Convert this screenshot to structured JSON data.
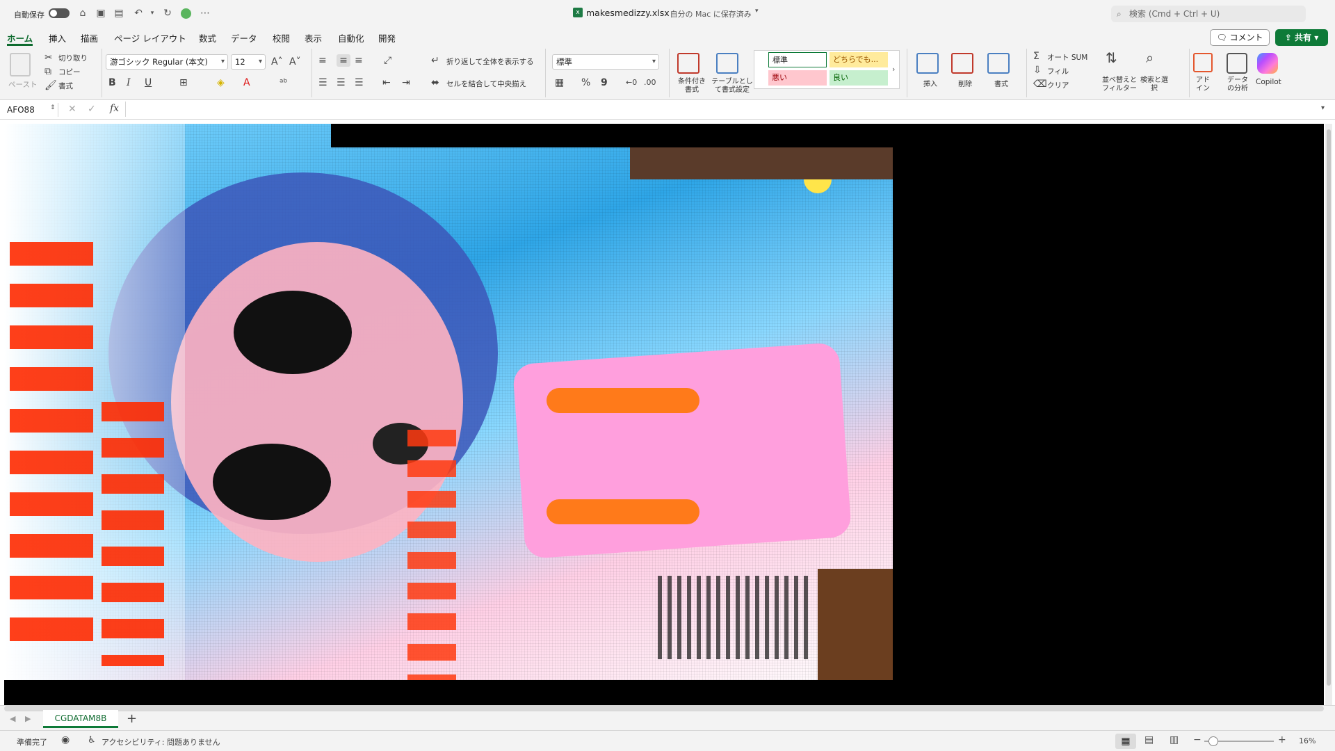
{
  "titlebar": {
    "autosave_label": "自動保存",
    "file_name": "makesmedizzy.xlsx",
    "save_status": "- 自分の Mac に保存済み",
    "search_placeholder": "検索 (Cmd + Ctrl + U)",
    "comment_label": "コメント",
    "share_label": "共有"
  },
  "ribbon_tabs": [
    {
      "label": "ホーム",
      "active": true
    },
    {
      "label": "挿入"
    },
    {
      "label": "描画"
    },
    {
      "label": "ページ レイアウト"
    },
    {
      "label": "数式"
    },
    {
      "label": "データ"
    },
    {
      "label": "校閲"
    },
    {
      "label": "表示"
    },
    {
      "label": "自動化"
    },
    {
      "label": "開発"
    }
  ],
  "clipboard": {
    "paste": "ペースト",
    "cut": "切り取り",
    "copy": "コピー",
    "format_painter": "書式"
  },
  "font": {
    "name": "游ゴシック Regular (本文)",
    "size": "12",
    "bold": "B",
    "italic": "I",
    "underline": "U"
  },
  "alignment": {
    "wrap_text": "折り返して全体を表示する",
    "merge_center": "セルを結合して中央揃え"
  },
  "number": {
    "format": "標準",
    "percent": "%",
    "comma": "9"
  },
  "styles": {
    "conditional": "条件付き書式",
    "as_table": "テーブルとして書式設定",
    "normal": "標準",
    "neutral": "どちらでも...",
    "bad": "悪い",
    "good": "良い"
  },
  "cells": {
    "insert": "挿入",
    "delete": "削除",
    "format": "書式"
  },
  "editing": {
    "autosum": "オート SUM",
    "fill": "フィル",
    "clear": "クリア",
    "sort_filter": "並べ替えとフィルター",
    "find_select": "検索と選択"
  },
  "addins": {
    "addin": "アドイン",
    "analyze": "データの分析",
    "copilot": "Copilot"
  },
  "formula_bar": {
    "name_box": "AFO88",
    "fx": "fx",
    "value": ""
  },
  "sheet_tabs": [
    {
      "label": "CGDATAM8B",
      "active": true
    }
  ],
  "status": {
    "ready": "準備完了",
    "accessibility": "アクセシビリティ: 問題ありません",
    "zoom": "16%"
  },
  "colors": {
    "accent": "#0e7a38",
    "ribbon_bg": "#f3f3f3",
    "bad_bg": "#ffc7ce",
    "neutral_bg": "#ffeb9c",
    "good_bg": "#c6efce"
  }
}
